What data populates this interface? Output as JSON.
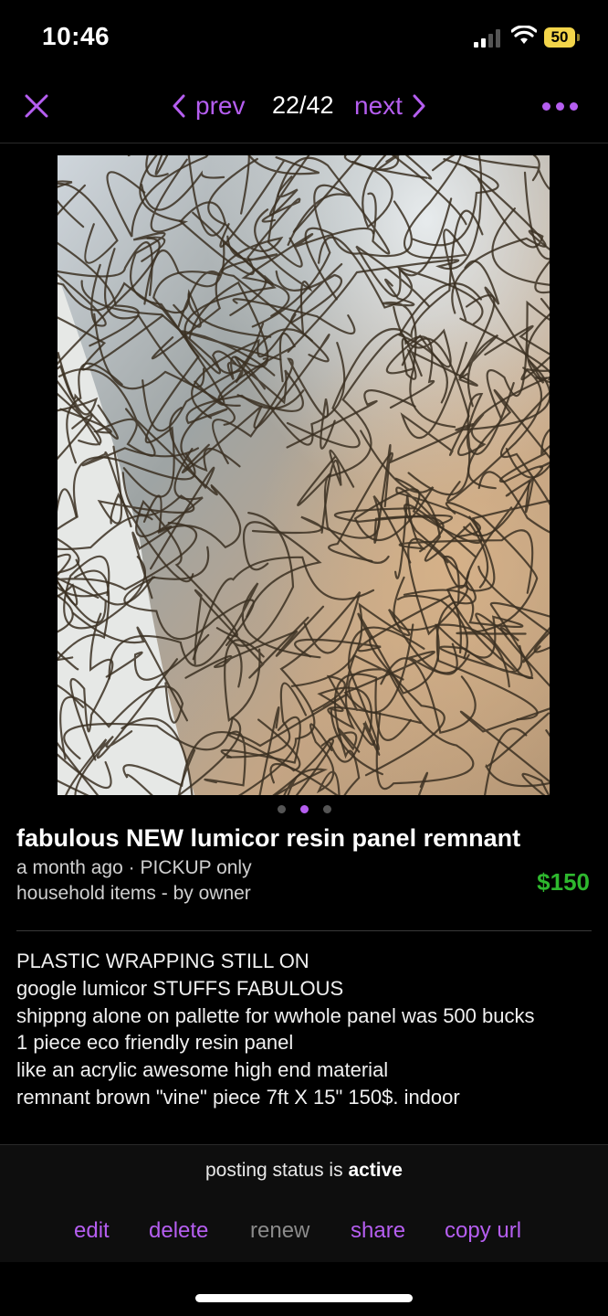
{
  "status_bar": {
    "time": "10:46",
    "battery_level": "50",
    "battery_color": "#f3d54a"
  },
  "nav": {
    "prev_label": "prev",
    "counter": "22/42",
    "next_label": "next",
    "close_icon": "close-icon",
    "more_icon": "more-dots-icon",
    "accent_color": "#b55ef0"
  },
  "gallery": {
    "page_count": 3,
    "active_page": 2
  },
  "listing": {
    "title": "fabulous NEW lumicor resin panel remnant",
    "time_ago": "a month ago",
    "delivery": "PICKUP only",
    "category": "household items - by owner",
    "price": "$150",
    "price_color": "#2eb82e"
  },
  "description": {
    "lines": [
      "PLASTIC WRAPPING STILL ON",
      "google lumicor STUFFS FABULOUS",
      "shippng alone on pallette for wwhole panel was 500 bucks",
      "1 piece eco friendly resin panel",
      "like an acrylic awesome high end material",
      "remnant brown \"vine\" piece 7ft X 15\" 150$. indoor"
    ]
  },
  "footer": {
    "status_prefix": "posting status is",
    "status_value": "active",
    "actions": {
      "edit": "edit",
      "delete": "delete",
      "renew": "renew",
      "share": "share",
      "copy_url": "copy url"
    }
  }
}
